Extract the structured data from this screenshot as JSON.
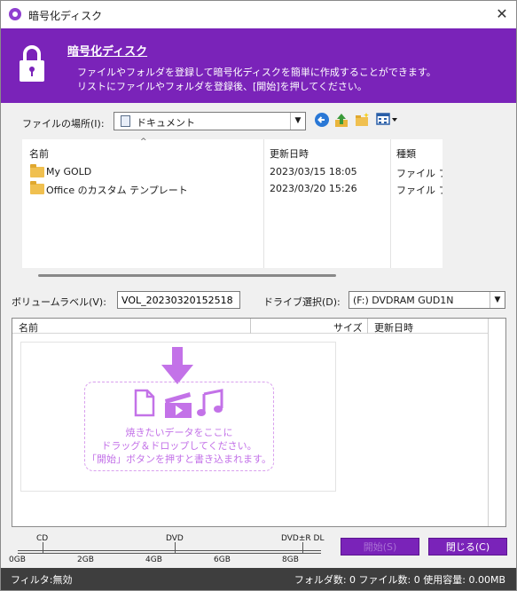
{
  "window": {
    "title": "暗号化ディスク",
    "close_glyph": "✕"
  },
  "banner": {
    "title": "暗号化ディスク",
    "desc_line1": "ファイルやフォルダを登録して暗号化ディスクを簡単に作成することができます。",
    "desc_line2": "リストにファイルやフォルダを登録後、[開始]を押してください。",
    "icon": "lock-icon"
  },
  "location": {
    "label": "ファイルの場所(I):",
    "selected": "ドキュメント"
  },
  "browser": {
    "columns": [
      "名前",
      "更新日時",
      "種類"
    ],
    "rows": [
      {
        "name": "My GOLD",
        "date": "2023/03/15 18:05",
        "type": "ファイル フォ"
      },
      {
        "name": "Office のカスタム テンプレート",
        "date": "2023/03/20 15:26",
        "type": "ファイル フォ"
      }
    ]
  },
  "volume": {
    "label": "ボリュームラベル(V):",
    "value": "VOL_20230320152518"
  },
  "drive": {
    "label": "ドライブ選択(D):",
    "selected": "(F:) DVDRAM GUD1N"
  },
  "writelist": {
    "columns": [
      "名前",
      "サイズ",
      "更新日時"
    ],
    "drop_line1": "焼きたいデータをここに",
    "drop_line2": "ドラッグ＆ドロップしてください。",
    "drop_line3": "「開始」ボタンを押すと書き込まれます。"
  },
  "capacity": {
    "top_labels": [
      "CD",
      "DVD",
      "DVD±R DL"
    ],
    "bottom_labels": [
      "0GB",
      "2GB",
      "4GB",
      "6GB",
      "8GB"
    ]
  },
  "buttons": {
    "start": "開始(S)",
    "close": "閉じる(C)"
  },
  "status": {
    "left": "フィルタ:無効",
    "right": "フォルダ数: 0  ファイル数: 0  使用容量: 0.00MB"
  },
  "colors": {
    "accent": "#7a23b9",
    "drop_hint": "#c372e8",
    "status_bg": "#3e3e3e"
  }
}
